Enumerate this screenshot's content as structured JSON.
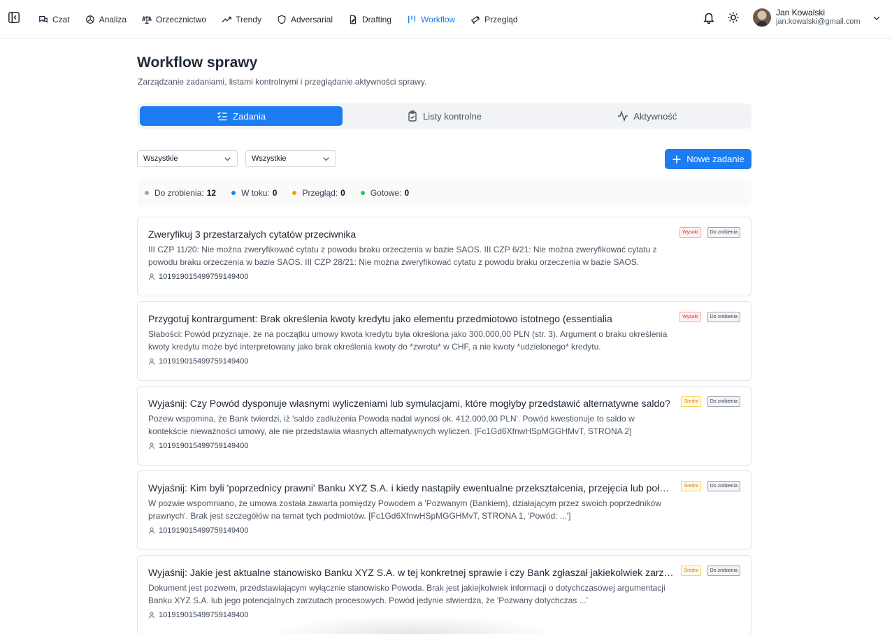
{
  "nav": {
    "items": [
      {
        "label": "Czat",
        "icon": "chat-icon"
      },
      {
        "label": "Analiza",
        "icon": "analysis-icon"
      },
      {
        "label": "Orzecznictwo",
        "icon": "scales-icon"
      },
      {
        "label": "Trendy",
        "icon": "trending-icon"
      },
      {
        "label": "Adversarial",
        "icon": "shield-icon"
      },
      {
        "label": "Drafting",
        "icon": "document-edit-icon"
      },
      {
        "label": "Workflow",
        "icon": "workflow-icon"
      },
      {
        "label": "Przegląd",
        "icon": "review-icon"
      }
    ],
    "active": "Workflow"
  },
  "user": {
    "name": "Jan Kowalski",
    "email": "jan.kowalski@gmail.com"
  },
  "page": {
    "title": "Workflow sprawy",
    "subtitle": "Zarządzanie zadaniami, listami kontrolnymi i przeglądanie aktywności sprawy."
  },
  "tabs": [
    {
      "label": "Zadania",
      "icon": "list-check-icon",
      "active": true
    },
    {
      "label": "Listy kontrolne",
      "icon": "clipboard-check-icon",
      "active": false
    },
    {
      "label": "Aktywność",
      "icon": "activity-icon",
      "active": false
    }
  ],
  "filters": {
    "status": "Wszystkie",
    "priority": "Wszystkie"
  },
  "new_task_label": "Nowe zadanie",
  "stats": [
    {
      "label": "Do zrobienia:",
      "value": "12",
      "color": "#9ca3af"
    },
    {
      "label": "W toku:",
      "value": "0",
      "color": "#1d7cf2"
    },
    {
      "label": "Przegląd:",
      "value": "0",
      "color": "#f59e0b"
    },
    {
      "label": "Gotowe:",
      "value": "0",
      "color": "#22c55e"
    }
  ],
  "tasks": [
    {
      "title": "Zweryfikuj 3 przestarzałych cytatów przeciwnika",
      "description": "III CZP 11/20: Nie można zweryfikować cytatu z powodu braku orzeczenia w bazie SAOS. III CZP 6/21: Nie można zweryfikować cytatu z powodu braku orzeczenia w bazie SAOS. III CZP 28/21: Nie można zweryfikować cytatu z powodu braku orzeczenia w bazie SAOS.",
      "assignee": "101919015499759149400",
      "priority": "Wysoki",
      "status": "Do zrobienia"
    },
    {
      "title": "Przygotuj kontrargument: Brak określenia kwoty kredytu jako elementu przedmiotowo istotnego (essentialia",
      "description": "Słabości: Powód przyznaje, że na początku umowy kwota kredytu była określona jako 300.000,00 PLN (str. 3). Argument o braku określenia kwoty kredytu może być interpretowany jako brak określenia kwoty do *zwrotu* w CHF, a nie kwoty *udzielonego* kredytu.",
      "assignee": "101919015499759149400",
      "priority": "Wysoki",
      "status": "Do zrobienia"
    },
    {
      "title": "Wyjaśnij: Czy Powód dysponuje własnymi wyliczeniami lub symulacjami, które mogłyby przedstawić alternatywne saldo?",
      "description": "Pozew wspomina, że Bank twierdzi, iż 'saldo zadłużenia Powoda nadal wynosi ok. 412.000,00 PLN'. Powód kwestionuje to saldo w kontekście nieważności umowy, ale nie przedstawia własnych alternatywnych wyliczeń. [Fc1Gd6XfnwHSpMGGHMvT, STRONA 2]",
      "assignee": "101919015499759149400",
      "priority": "Średni",
      "status": "Do zrobienia"
    },
    {
      "title": "Wyjaśnij: Kim byli 'poprzednicy prawni' Banku XYZ S.A. i kiedy nastąpiły ewentualne przekształcenia, przejęcia lub połączenia?",
      "description": "W pozwie wspomniano, że umowa została zawarta pomiędzy Powodem a 'Pozwanym (Bankiem), działającym przez swoich poprzedników prawnych'. Brak jest szczegółów na temat tych podmiotów. [Fc1Gd6XfnwHSpMGGHMvT, STRONA 1, 'Powód: ...']",
      "assignee": "101919015499759149400",
      "priority": "Średni",
      "status": "Do zrobienia"
    },
    {
      "title": "Wyjaśnij: Jakie jest aktualne stanowisko Banku XYZ S.A. w tej konkretnej sprawie i czy Bank zgłaszał jakiekolwiek zarzuty?",
      "description": "Dokument jest pozwem, przedstawiającym wyłącznie stanowisko Powoda. Brak jest jakiejkolwiek informacji o dotychczasowej argumentacji Banku XYZ S.A. lub jego potencjalnych zarzutach procesowych. Powód jedynie stwierdza, że 'Pozwany dotychczas ...'",
      "assignee": "101919015499759149400",
      "priority": "Średni",
      "status": "Do zrobienia"
    }
  ]
}
